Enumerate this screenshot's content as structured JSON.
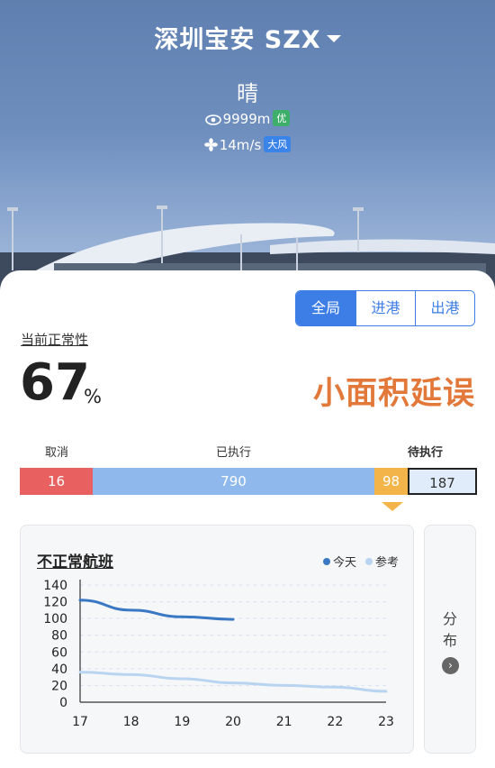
{
  "header": {
    "airport": "深圳宝安 SZX",
    "weather": "晴",
    "visibility": "9999m",
    "visibility_grade": "优",
    "wind": "14m/s",
    "wind_grade": "大风"
  },
  "tabs": {
    "all": "全局",
    "arrive": "进港",
    "depart": "出港"
  },
  "normality": {
    "label": "当前正常性",
    "value": "67",
    "unit": "%",
    "status": "小面积延误"
  },
  "flights": {
    "cancel_label": "取消",
    "done_label": "已执行",
    "wait_label": "待执行",
    "cancelled": "16",
    "executed": "790",
    "waiting_highlight": "98",
    "waiting": "187"
  },
  "chart_panel": {
    "title": "不正常航班",
    "legend_today": "今天",
    "legend_ref": "参考"
  },
  "side": {
    "text1": "分",
    "text2": "布"
  },
  "colors": {
    "primary": "#3d7de6",
    "today": "#3a78c4",
    "ref": "#b9d4f0",
    "cancel": "#e86060",
    "wait": "#f3b54a",
    "status": "#e2793a"
  },
  "chart_data": {
    "type": "line",
    "x": [
      17,
      18,
      19,
      20,
      21,
      22,
      23
    ],
    "ylim": [
      0,
      140
    ],
    "yticks": [
      0,
      20,
      40,
      60,
      80,
      100,
      120,
      140
    ],
    "series": [
      {
        "name": "今天",
        "x": [
          17,
          18,
          19,
          20
        ],
        "values": [
          122,
          110,
          102,
          99
        ]
      },
      {
        "name": "参考",
        "x": [
          17,
          18,
          19,
          20,
          21,
          22,
          23
        ],
        "values": [
          36,
          33,
          28,
          23,
          20,
          18,
          13
        ]
      }
    ]
  }
}
